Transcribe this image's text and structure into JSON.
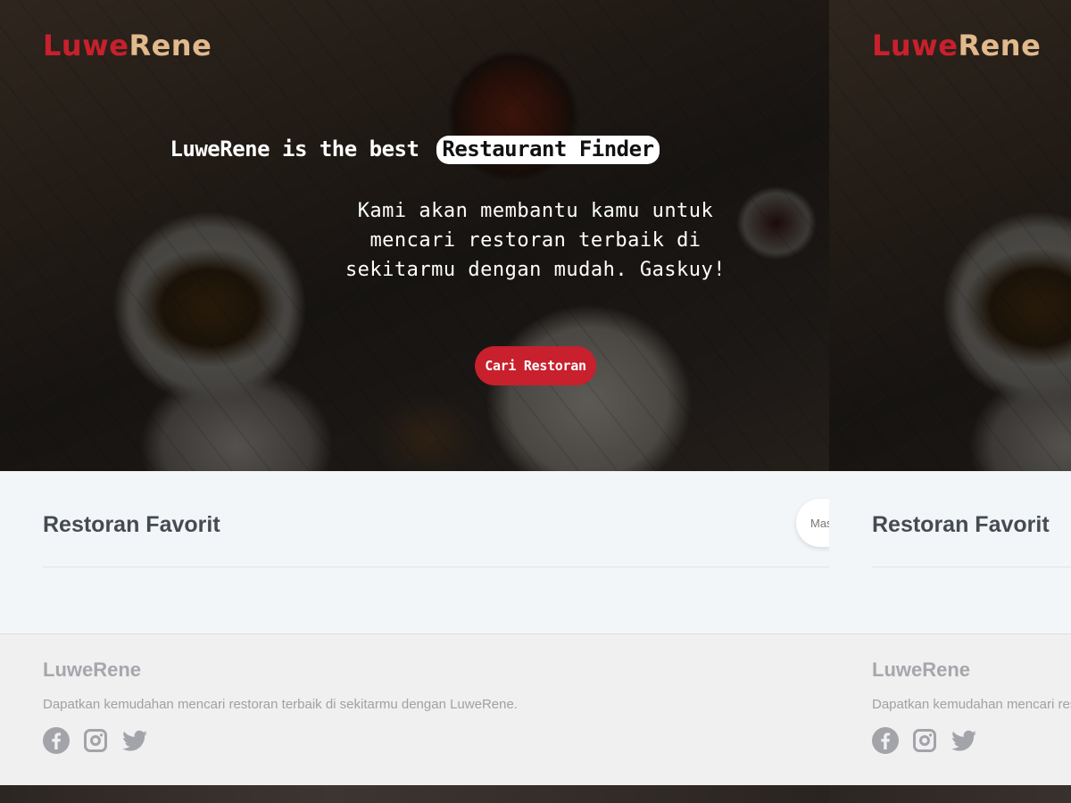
{
  "brand": {
    "part1": "Luwe",
    "part2": "Rene"
  },
  "hero": {
    "headline_prefix": "LuweRene is the best",
    "headline_highlight": "Restaurant Finder",
    "tagline": "Kami akan membantu kamu untuk mencari restoran terbaik di sekitarmu dengan mudah. Gaskuy!",
    "cta_label": "Cari Restoran"
  },
  "favorites": {
    "title": "Restoran Favorit",
    "search_placeholder": "Masukkan nama restoran"
  },
  "footer": {
    "brand": "LuweRene",
    "description": "Dapatkan kemudahan mencari restoran terbaik di sekitarmu dengan LuweRene.",
    "socials": [
      "facebook-icon",
      "instagram-icon",
      "twitter-icon"
    ]
  },
  "colors": {
    "brand_red": "#c8202c",
    "brand_tan": "#e2b98d",
    "section_bg": "#f3f6f9",
    "footer_bg": "#f0f0f0",
    "muted_text": "#a7a6ad"
  }
}
